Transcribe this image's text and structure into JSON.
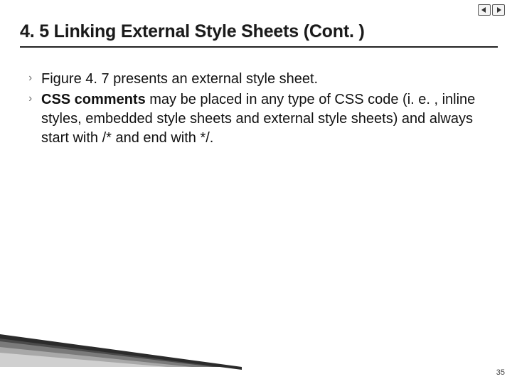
{
  "nav": {
    "prev_name": "prev-arrow-icon",
    "next_name": "next-arrow-icon"
  },
  "heading": "4. 5 Linking External Style Sheets (Cont. )",
  "bullets": [
    {
      "text": "Figure 4. 7 presents an external style sheet."
    },
    {
      "bold": "CSS comments",
      "rest": " may be placed in any type of CSS code (i. e. , inline styles, embedded style sheets and external style sheets) and always start with /* and end with */."
    }
  ],
  "page_number": "35"
}
